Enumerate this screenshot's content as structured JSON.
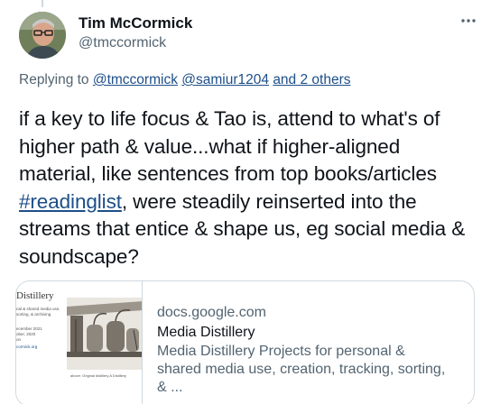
{
  "tweet": {
    "author": {
      "display_name": "Tim McCormick",
      "handle": "@tmccormick"
    },
    "replying_to": {
      "prefix": "Replying to",
      "mention_1": "@tmccormick",
      "mention_2": "@samiur1204",
      "others": "and 2 others"
    },
    "text": {
      "part_1": "if a key to life focus & Tao is, attend to what's of higher path & value...what if higher-aligned material, like sentences from top books/articles ",
      "hashtag": "#readinglist",
      "part_2": ", were steadily reinserted into the streams that entice & shape us, eg social media & soundscape?"
    },
    "link_card": {
      "domain": "docs.google.com",
      "title": "Media Distillery",
      "description": "Media Distillery Projects for personal & shared media use, creation, tracking, sorting, & ...",
      "thumbnail": {
        "title": "Distillery",
        "subtitle": "nal & shared media use, sorting, & archiving",
        "date": "ecember 2021",
        "date_2": "ober, 2020",
        "line_3": "on",
        "link": "cormick.org",
        "caption": "above: Original distillery A Distillery"
      }
    },
    "icons": {
      "more": "more-horizontal-icon",
      "avatar": "avatar"
    },
    "colors": {
      "link": "#1d4e89",
      "secondary_text": "#536471",
      "border": "#cfd9de"
    }
  }
}
